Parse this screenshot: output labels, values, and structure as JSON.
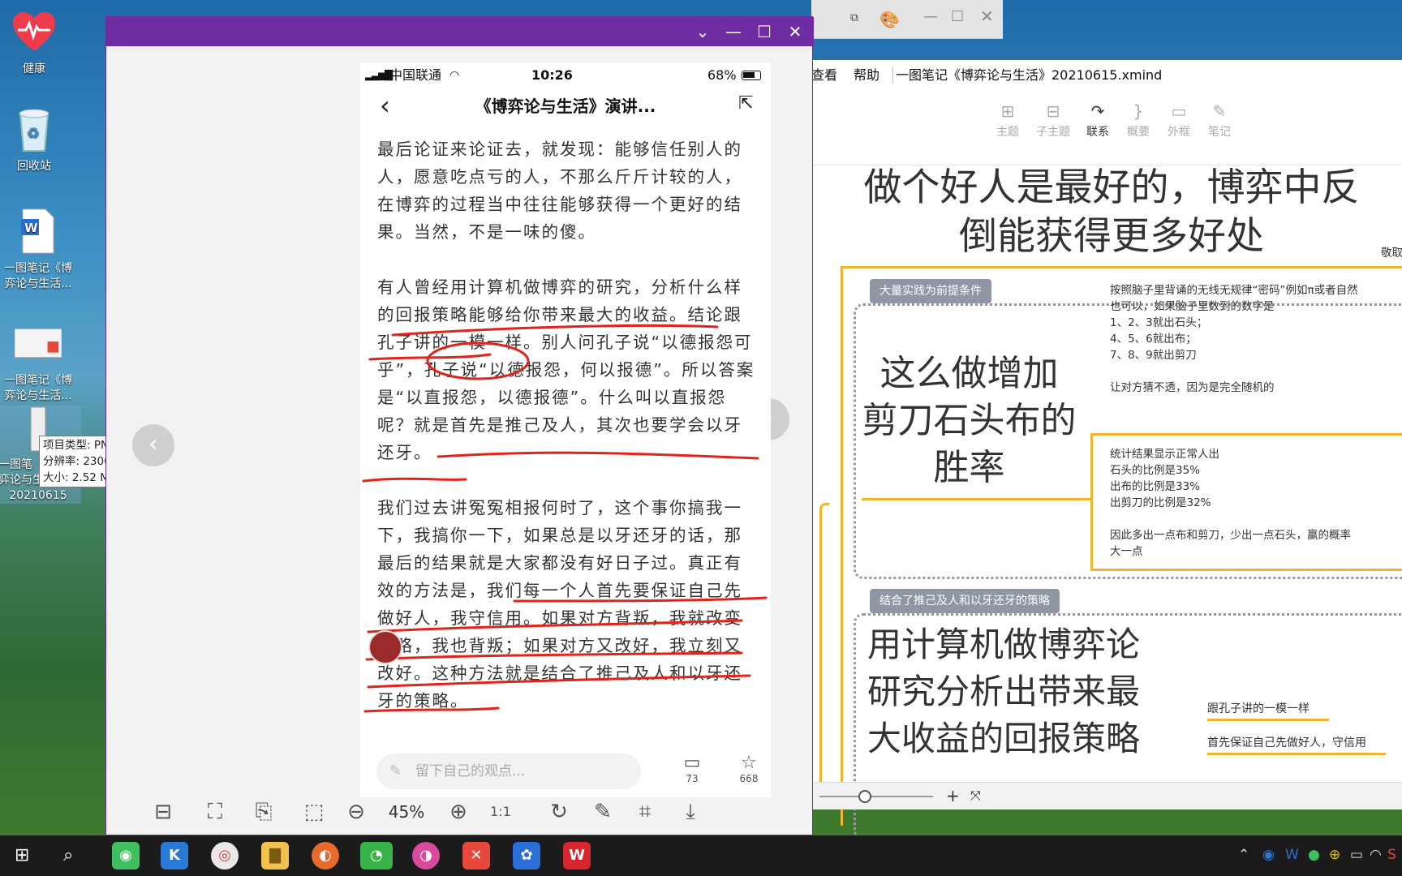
{
  "desktop": {
    "icons": [
      {
        "label": "健康"
      },
      {
        "label": "回收站"
      },
      {
        "label": "一图笔记《博弈论与生活..."
      },
      {
        "label": "一图笔记《博弈论与生活..."
      },
      {
        "label_1": "一图笔",
        "label_2": "弈论与生",
        "label_3": "20210615"
      }
    ],
    "tooltip": {
      "line1": "项目类型: PNG 文件",
      "line2": "分辨率: 2306 x 9160",
      "line3": "大小: 2.52 MB"
    }
  },
  "phone": {
    "status": {
      "carrier": "中国联通",
      "time": "10:26",
      "battery": "68%"
    },
    "title": "《博弈论与生活》演讲...",
    "paragraphs": [
      [
        "最后论证来论证去，就发现：能够信任别人的",
        "人，愿意吃点亏的人，不那么斤斤计较的人，",
        "在博弈的过程当中往往能够获得一个更好的结",
        "果。当然，不是一味的傻。"
      ],
      [
        "有人曾经用计算机做博弈的研究，分析什么样",
        "的回报策略能够给你带来最大的收益。结论跟",
        "孔子讲的一模一样。别人问孔子说“以德报怨可",
        "乎”，孔子说“以德报怨，何以报德”。所以答案",
        "是“以直报怨，以德报德”。什么叫以直报怨",
        "呢？就是首先是推己及人，其次也要学会以牙",
        "还牙。"
      ],
      [
        "我们过去讲冤冤相报何时了，这个事你搞我一",
        "下，我搞你一下，如果总是以牙还牙的话，那",
        "最后的结果就是大家都没有好日子过。真正有",
        "效的方法是，我们每一个人首先要保证自己先",
        "做好人，我守信用。如果对方背叛，我就改变",
        "策略，我也背叛；如果对方又改好，我立刻又",
        "改好。这种方法就是结合了推己及人和以牙还",
        "牙的策略。"
      ]
    ],
    "comment_placeholder": "留下自己的观点...",
    "comment_count": "73",
    "like_count": "668"
  },
  "viewer": {
    "zoom": "45%"
  },
  "xmind": {
    "menu": [
      "查看",
      "帮助"
    ],
    "file": "一图笔记《博弈论与生活》20210615.xmind",
    "tools": [
      "主题",
      "子主题",
      "联系",
      "概要",
      "外框",
      "笔记"
    ],
    "title_line1": "做个好人是最好的，博弈中反",
    "title_line2": "倒能获得更多好处",
    "side": "敬取",
    "s1": {
      "tag": "大量实践为前提条件",
      "big": [
        "这么做增加",
        "剪刀石头布的",
        "胜率"
      ],
      "notes_a": [
        "按照脑子里背诵的无线无规律“密码”例如π或者自然",
        "也可以，如果脑子里数到的数字是",
        "1、2、3就出石头；",
        "4、5、6就出布；",
        "7、8、9就出剪刀",
        "",
        "让对方猜不透，因为是完全随机的"
      ],
      "notes_b": [
        "统计结果显示正常人出",
        "石头的比例是35%",
        "出布的比例是33%",
        "出剪刀的比例是32%",
        "",
        "因此多出一点布和剪刀，少出一点石头，赢的概率",
        "大一点"
      ]
    },
    "s2": {
      "tag": "结合了推己及人和以牙还牙的策略",
      "big": [
        "用计算机做博弈论",
        "研究分析出带来最",
        "大收益的回报策略"
      ],
      "n1": "跟孔子讲的一模一样",
      "n2": "首先保证自己先做好人，守信用"
    }
  }
}
